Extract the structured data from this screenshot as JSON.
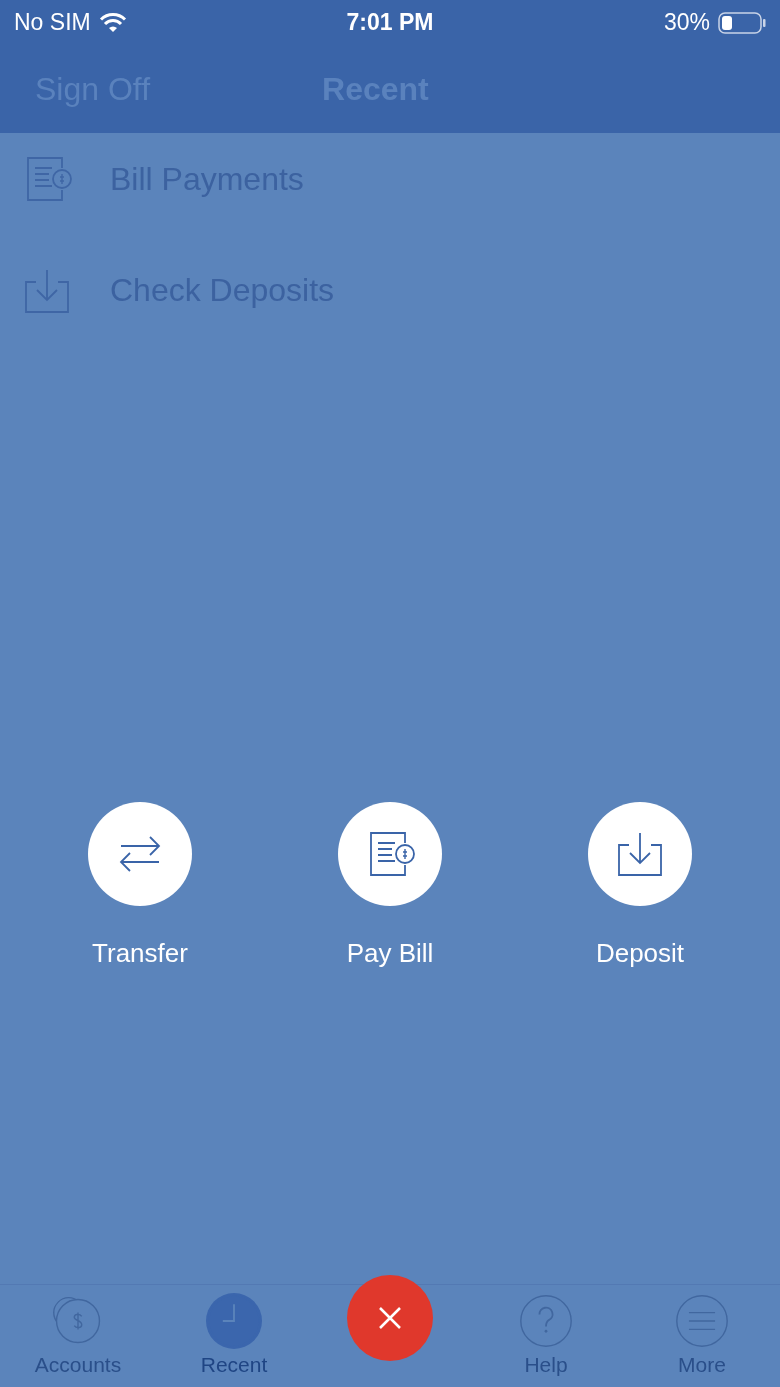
{
  "status_bar": {
    "carrier": "No SIM",
    "time": "7:01 PM",
    "battery": "30%"
  },
  "nav_bar": {
    "left_button": "Sign Off",
    "title": "Recent"
  },
  "recent_items": [
    {
      "kind": "bill",
      "label": "Bill Payments"
    },
    {
      "kind": "deposit",
      "label": "Check Deposits"
    }
  ],
  "actions": [
    {
      "kind": "transfer",
      "label": "Transfer"
    },
    {
      "kind": "bill",
      "label": "Pay Bill"
    },
    {
      "kind": "deposit",
      "label": "Deposit"
    }
  ],
  "tab_bar": [
    {
      "kind": "accounts",
      "label": "Accounts",
      "selected": false
    },
    {
      "kind": "recent",
      "label": "Recent",
      "selected": true
    },
    {
      "kind": "close"
    },
    {
      "kind": "help",
      "label": "Help",
      "selected": false
    },
    {
      "kind": "more",
      "label": "More",
      "selected": false
    }
  ]
}
